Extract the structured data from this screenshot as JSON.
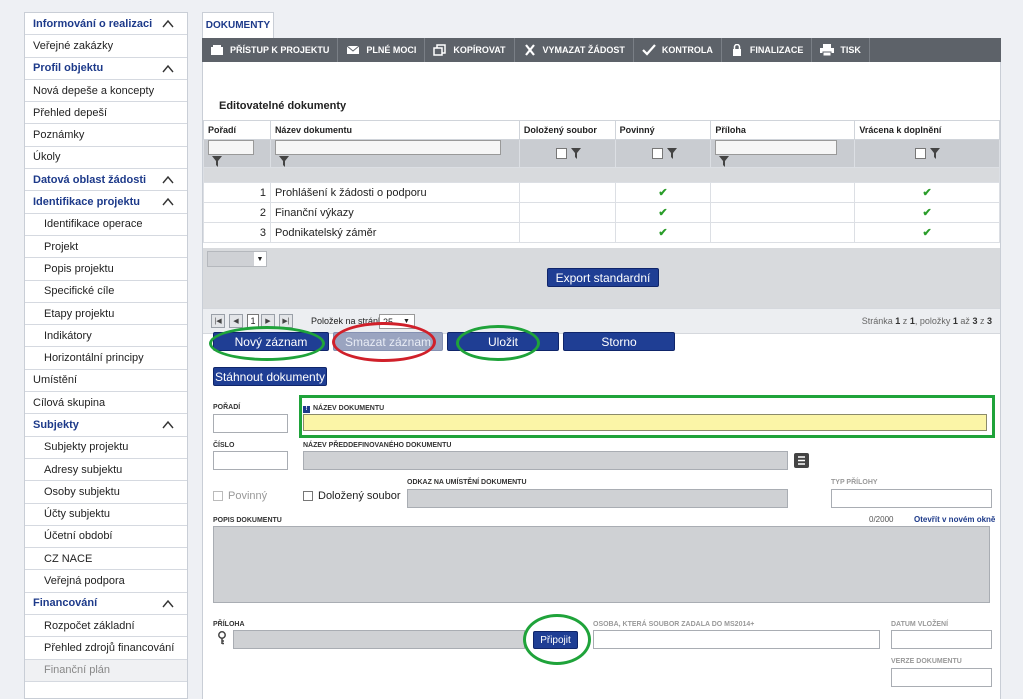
{
  "sidebar": {
    "items": [
      {
        "label": "Informování o realizaci",
        "type": "section",
        "chevron": true
      },
      {
        "label": "Veřejné zakázky",
        "type": "item"
      },
      {
        "label": "Profil objektu",
        "type": "section",
        "chevron": true
      },
      {
        "label": "Nová depeše a koncepty",
        "type": "item"
      },
      {
        "label": "Přehled depeší",
        "type": "item"
      },
      {
        "label": "Poznámky",
        "type": "item"
      },
      {
        "label": "Úkoly",
        "type": "item"
      },
      {
        "label": "Datová oblast žádosti",
        "type": "section",
        "chevron": true
      },
      {
        "label": "Identifikace projektu",
        "type": "section",
        "chevron": true
      },
      {
        "label": "Identifikace operace",
        "type": "sub"
      },
      {
        "label": "Projekt",
        "type": "sub"
      },
      {
        "label": "Popis projektu",
        "type": "sub"
      },
      {
        "label": "Specifické cíle",
        "type": "sub"
      },
      {
        "label": "Etapy projektu",
        "type": "sub"
      },
      {
        "label": "Indikátory",
        "type": "sub"
      },
      {
        "label": "Horizontální principy",
        "type": "sub"
      },
      {
        "label": "Umístění",
        "type": "item"
      },
      {
        "label": "Cílová skupina",
        "type": "item"
      },
      {
        "label": "Subjekty",
        "type": "section",
        "chevron": true
      },
      {
        "label": "Subjekty projektu",
        "type": "sub"
      },
      {
        "label": "Adresy subjektu",
        "type": "sub"
      },
      {
        "label": "Osoby subjektu",
        "type": "sub"
      },
      {
        "label": "Účty subjektu",
        "type": "sub"
      },
      {
        "label": "Účetní období",
        "type": "sub"
      },
      {
        "label": "CZ NACE",
        "type": "sub"
      },
      {
        "label": "Veřejná podpora",
        "type": "sub"
      },
      {
        "label": "Financování",
        "type": "section",
        "chevron": true
      },
      {
        "label": "Rozpočet základní",
        "type": "sub"
      },
      {
        "label": "Přehled zdrojů financování",
        "type": "sub"
      },
      {
        "label": "Finanční plán",
        "type": "sub-muted"
      }
    ]
  },
  "tab": {
    "label": "DOKUMENTY"
  },
  "toolbar": {
    "buttons": [
      {
        "label": "PŘÍSTUP K PROJEKTU",
        "icon": "lock-group-icon"
      },
      {
        "label": "PLNÉ MOCI",
        "icon": "envelope-icon"
      },
      {
        "label": "KOPÍROVAT",
        "icon": "copy-icon"
      },
      {
        "label": "VYMAZAT ŽÁDOST",
        "icon": "cross-icon"
      },
      {
        "label": "KONTROLA",
        "icon": "checkmark-icon"
      },
      {
        "label": "FINALIZACE",
        "icon": "padlock-icon"
      },
      {
        "label": "TISK",
        "icon": "printer-icon"
      }
    ]
  },
  "section_title": "Editovatelné dokumenty",
  "table": {
    "columns": [
      "Pořadí",
      "Název dokumentu",
      "Doložený soubor",
      "Povinný",
      "Příloha",
      "Vrácena k doplnění"
    ],
    "rows": [
      {
        "poradi": "1",
        "nazev": "Prohlášení k žádosti o podporu",
        "povinny": "✔",
        "vracena": "✔"
      },
      {
        "poradi": "2",
        "nazev": "Finanční výkazy",
        "povinny": "✔",
        "vracena": "✔"
      },
      {
        "poradi": "3",
        "nazev": "Podnikatelský záměr",
        "povinny": "✔",
        "vracena": "✔"
      }
    ]
  },
  "export_button": "Export standardní",
  "pager": {
    "current_page": "1",
    "per_page_label": "Položek na stránku",
    "per_page_value": "25",
    "info_prefix": "Stránka",
    "info_page": "1",
    "info_of": "z",
    "info_pages": "1",
    "info_items_label": ", položky",
    "info_from": "1",
    "info_to_label": "až",
    "info_to": "3",
    "info_total_of": "z",
    "info_total": "3"
  },
  "actions": {
    "new_record": "Nový záznam",
    "delete_record": "Smazat záznam",
    "save": "Uložit",
    "cancel": "Storno",
    "download": "Stáhnout dokumenty"
  },
  "form": {
    "poradi_label": "POŘADÍ",
    "nazev_label": "NÁZEV DOKUMENTU",
    "cislo_label": "ČÍSLO",
    "predef_label": "NÁZEV PŘEDDEFINOVANÉHO DOKUMENTU",
    "povinny_label": "Povinný",
    "dolozeny_label": "Doložený soubor",
    "odkaz_label": "ODKAZ NA UMÍSTĚNÍ DOKUMENTU",
    "typ_label": "TYP PŘÍLOHY",
    "popis_label": "POPIS DOKUMENTU",
    "char_count": "0/2000",
    "open_new_window": "Otevřít v novém okně",
    "priloha_label": "PŘÍLOHA",
    "attach_button": "Připojit",
    "osoba_label": "OSOBA, KTERÁ SOUBOR ZADALA DO MS2014+",
    "datum_label": "DATUM VLOŽENÍ",
    "verze_label": "VERZE DOKUMENTU"
  },
  "colors": {
    "accent": "#1f3e94",
    "highlight_green": "#1fa33a",
    "highlight_red": "#d0202a",
    "required_field": "#fbf5a7"
  }
}
